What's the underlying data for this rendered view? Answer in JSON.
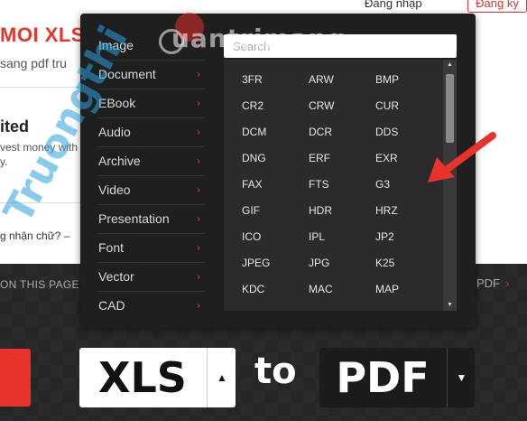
{
  "header": {
    "login_label": "Đăng nhập",
    "register_label": "Đăng ký"
  },
  "background": {
    "headline": "MOI XLS",
    "subtitle": "sang pdf tru",
    "heading2": "ited",
    "line1": "vest money with",
    "line2": "y.",
    "question": "g nhận chữ? –",
    "on_this_page": "ON THIS PAGE",
    "pdf_link": "PDF",
    "pdf_link_arrow": "›"
  },
  "converter": {
    "from_format": "XLS",
    "to_word": "to",
    "to_format": "PDF",
    "from_caret": "▲",
    "to_caret": "▼"
  },
  "dropdown": {
    "search_placeholder": "Search",
    "chevron": "›",
    "categories": [
      {
        "label": "Image"
      },
      {
        "label": "Document"
      },
      {
        "label": "EBook"
      },
      {
        "label": "Audio"
      },
      {
        "label": "Archive"
      },
      {
        "label": "Video"
      },
      {
        "label": "Presentation"
      },
      {
        "label": "Font"
      },
      {
        "label": "Vector"
      },
      {
        "label": "CAD"
      }
    ],
    "formats": [
      "3FR",
      "ARW",
      "BMP",
      "CR2",
      "CRW",
      "CUR",
      "DCM",
      "DCR",
      "DDS",
      "DNG",
      "ERF",
      "EXR",
      "FAX",
      "FTS",
      "G3",
      "GIF",
      "HDR",
      "HRZ",
      "ICO",
      "IPL",
      "JP2",
      "JPEG",
      "JPG",
      "K25",
      "KDC",
      "MAC",
      "MAP"
    ],
    "scroll_up": "▲",
    "scroll_down": "▼"
  },
  "watermark": {
    "vertical_text": "Truongthi",
    "horizontal_text": "uantrimang"
  },
  "colors": {
    "accent_red": "#e03a2f",
    "panel_bg": "#1f1f1f",
    "grid_bg": "#2b2b2b"
  },
  "icons": {
    "annotation": "red-arrow-icon",
    "chevron": "chevron-right-icon"
  }
}
